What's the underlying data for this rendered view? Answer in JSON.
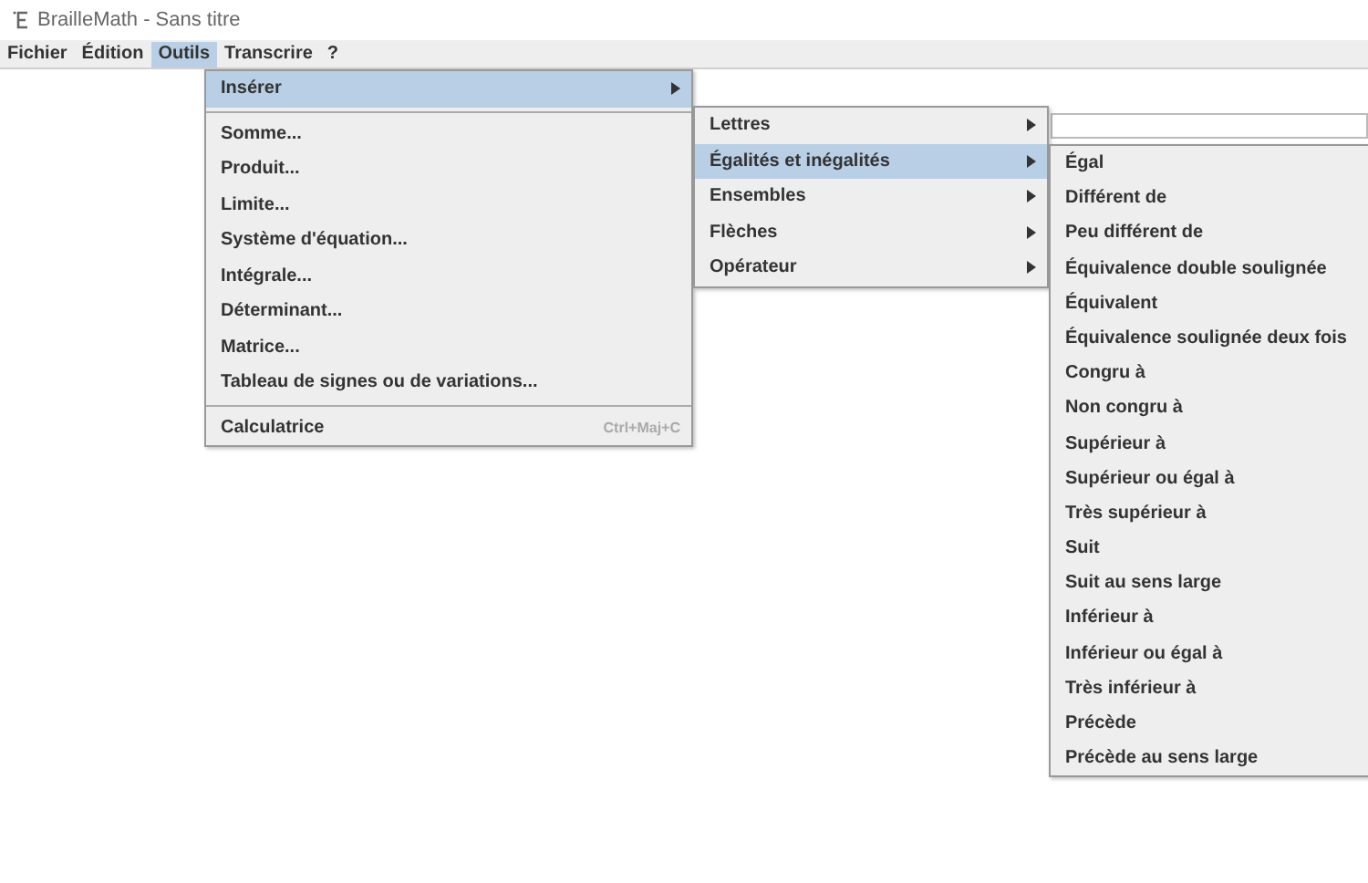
{
  "window": {
    "title": "BrailleMath - Sans titre"
  },
  "menubar": [
    {
      "label": "Fichier",
      "selected": false
    },
    {
      "label": "Édition",
      "selected": false
    },
    {
      "label": "Outils",
      "selected": true
    },
    {
      "label": "Transcrire",
      "selected": false
    },
    {
      "label": "?",
      "selected": false
    }
  ],
  "menu": [
    {
      "label": "Insérer",
      "kind": "submenu",
      "selected": true
    },
    {
      "kind": "separator"
    },
    {
      "label": "Somme...",
      "kind": "item",
      "selected": false
    },
    {
      "label": "Produit...",
      "kind": "item",
      "selected": false
    },
    {
      "label": "Limite...",
      "kind": "item",
      "selected": false
    },
    {
      "label": "Système d'équation...",
      "kind": "item",
      "selected": false
    },
    {
      "label": "Intégrale...",
      "kind": "item",
      "selected": false
    },
    {
      "label": "Déterminant...",
      "kind": "item",
      "selected": false
    },
    {
      "label": "Matrice...",
      "kind": "item",
      "selected": false
    },
    {
      "label": "Tableau de signes ou de variations...",
      "kind": "item",
      "selected": false
    },
    {
      "kind": "separator"
    },
    {
      "label": "Calculatrice",
      "kind": "item",
      "selected": false,
      "shortcut": "Ctrl+Maj+C"
    }
  ],
  "submenu": [
    {
      "label": "Lettres",
      "selected": false
    },
    {
      "label": "Égalités et inégalités",
      "selected": true
    },
    {
      "label": "Ensembles",
      "selected": false
    },
    {
      "label": "Flèches",
      "selected": false
    },
    {
      "label": "Opérateur",
      "selected": false
    }
  ],
  "submenu_2": [
    "Égal",
    "Différent de",
    "Peu différent de",
    "Équivalence double soulignée",
    "Équivalent",
    "Équivalence soulignée deux fois",
    "Congru à",
    "Non congru à",
    "Supérieur à",
    "Supérieur ou égal à",
    "Très supérieur à",
    "Suit",
    "Suit au sens large",
    "Inférieur à",
    "Inférieur ou égal à",
    "Très inférieur à",
    "Précède",
    "Précède au sens large"
  ]
}
